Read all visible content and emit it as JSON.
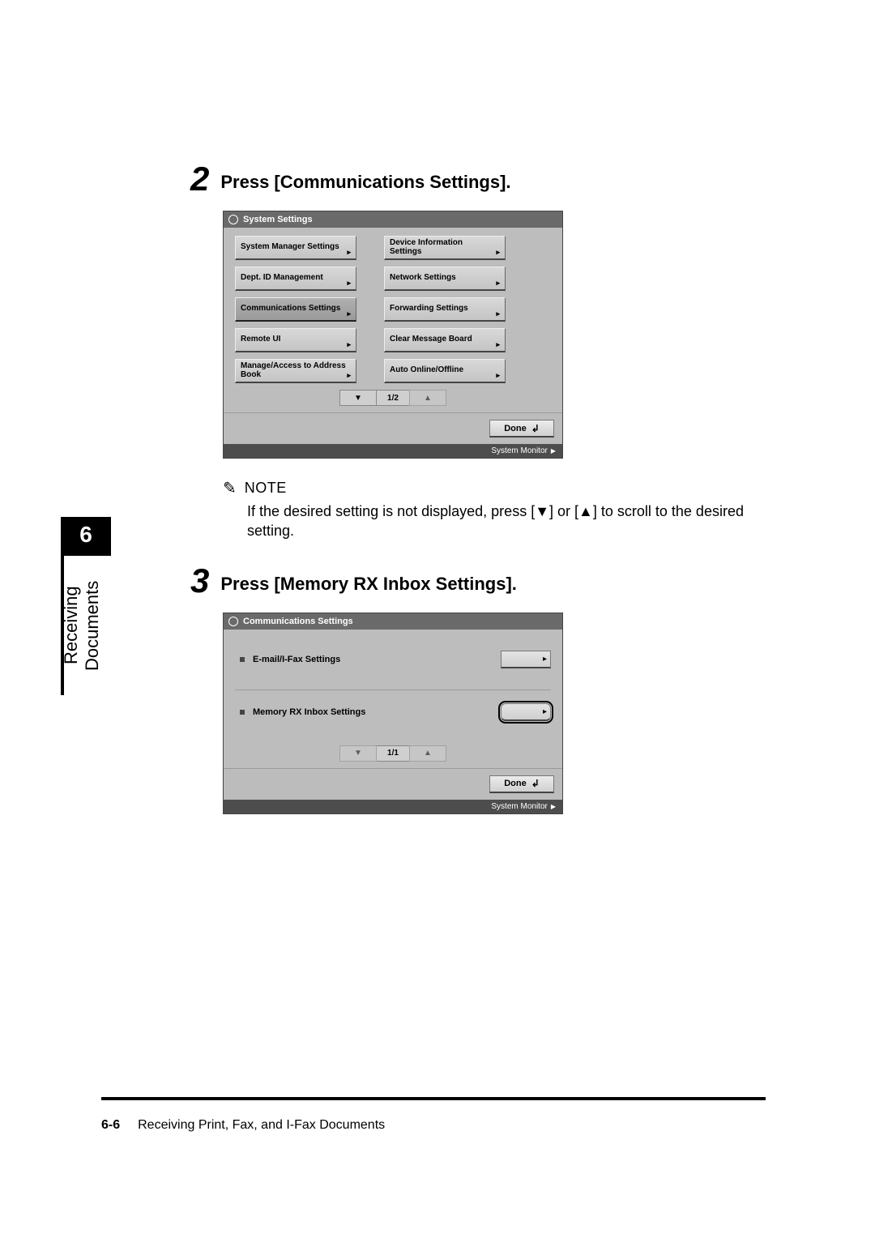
{
  "sidebar": {
    "chapter_number": "6",
    "chapter_label": "Receiving Documents"
  },
  "step2": {
    "number": "2",
    "title": "Press [Communications Settings].",
    "shot": {
      "title": "System Settings",
      "buttons_left": [
        "System Manager Settings",
        "Dept. ID Management",
        "Communications Settings",
        "Remote UI",
        "Manage/Access to Address Book"
      ],
      "buttons_right": [
        "Device Information Settings",
        "Network Settings",
        "Forwarding Settings",
        "Clear Message Board",
        "Auto Online/Offline"
      ],
      "page_indicator": "1/2",
      "down": "▼",
      "up": "▲",
      "done": "Done",
      "sysmon": "System Monitor"
    }
  },
  "note": {
    "label": "NOTE",
    "text_prefix": "If the desired setting is not displayed, press [",
    "down": "▼",
    "mid": "] or [",
    "up": "▲",
    "text_suffix": "] to scroll to the desired setting."
  },
  "step3": {
    "number": "3",
    "title": "Press [Memory RX Inbox Settings].",
    "shot": {
      "title": "Communications Settings",
      "items": [
        "E-mail/I-Fax Settings",
        "Memory RX Inbox Settings"
      ],
      "page_indicator": "1/1",
      "down": "▼",
      "up": "▲",
      "done": "Done",
      "sysmon": "System Monitor"
    }
  },
  "footer": {
    "page": "6-6",
    "title": "Receiving Print, Fax, and I-Fax Documents"
  }
}
